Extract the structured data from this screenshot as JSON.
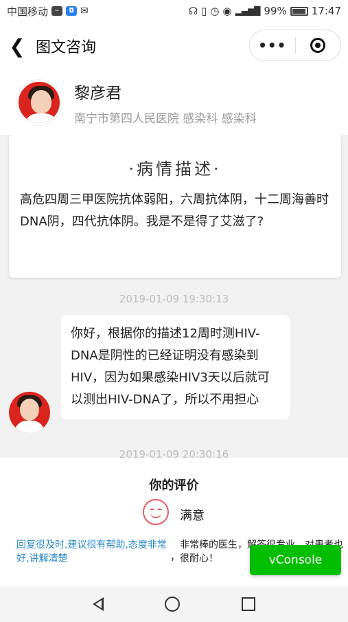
{
  "status_bar": {
    "carrier": "中国移动",
    "battery": "99%",
    "time": "17:47",
    "icons": [
      "activity-icon",
      "shield-icon",
      "wechat-icon",
      "headset-icon",
      "vibrate-icon",
      "alarm-icon",
      "eye-icon",
      "signal-icon",
      "battery-icon"
    ]
  },
  "nav": {
    "back_icon": "chevron-left-icon",
    "title": "图文咨询",
    "more_label": "•••",
    "close_icon": "target-icon"
  },
  "doctor": {
    "name": "黎彦君",
    "subtitle": "南宁市第四人民医院   感染科 感染科"
  },
  "description": {
    "title": "·病情描述·",
    "text": "高危四周三甲医院抗体弱阳，六周抗体阴，十二周海善时DNA阴，四代抗体阴。我是不是得了艾滋了?"
  },
  "messages": [
    {
      "timestamp": "2019-01-09 19:30:13",
      "text": "你好，根据你的描述12周时测HIV-DNA是阴性的已经证明没有感染到HIV，因为如果感染HIV3天以后就可以测出HIV-DNA了，所以不用担心"
    }
  ],
  "next_timestamp": "2019-01-09 20:30:16",
  "rating": {
    "title": "你的评价",
    "label": "满意",
    "face_icon": "smiley-face-icon",
    "tags": "回复很及时,建议很有帮助,态度非常好,讲解清楚",
    "separator": "，",
    "comment": "非常棒的医生，解答很专业，对患者也很耐心！"
  },
  "vconsole": {
    "label": "vConsole",
    "color": "#04be02"
  },
  "system_nav": {
    "icons": [
      "back-triangle-icon",
      "home-circle-icon",
      "recents-square-icon"
    ]
  }
}
